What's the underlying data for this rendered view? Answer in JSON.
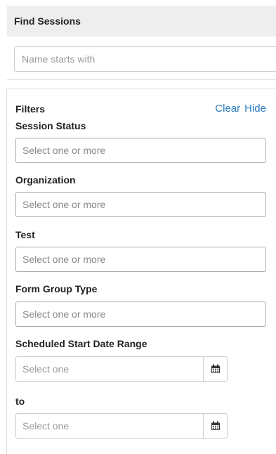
{
  "find_sessions": {
    "title": "Find Sessions",
    "name_placeholder": "Name starts with"
  },
  "filters": {
    "title": "Filters",
    "clear_label": "Clear",
    "hide_label": "Hide",
    "session_status": {
      "label": "Session Status",
      "placeholder": "Select one or more"
    },
    "organization": {
      "label": "Organization",
      "placeholder": "Select one or more"
    },
    "test": {
      "label": "Test",
      "placeholder": "Select one or more"
    },
    "form_group_type": {
      "label": "Form Group Type",
      "placeholder": "Select one or more"
    },
    "start_date_range": {
      "label": "Scheduled Start Date Range",
      "from_placeholder": "Select one",
      "to_label": "to",
      "to_placeholder": "Select one"
    }
  },
  "icons": {
    "calendar": "calendar-icon"
  },
  "colors": {
    "header_bg": "#eeeeee",
    "link": "#2a7bbf",
    "border": "#aaaaaa"
  }
}
